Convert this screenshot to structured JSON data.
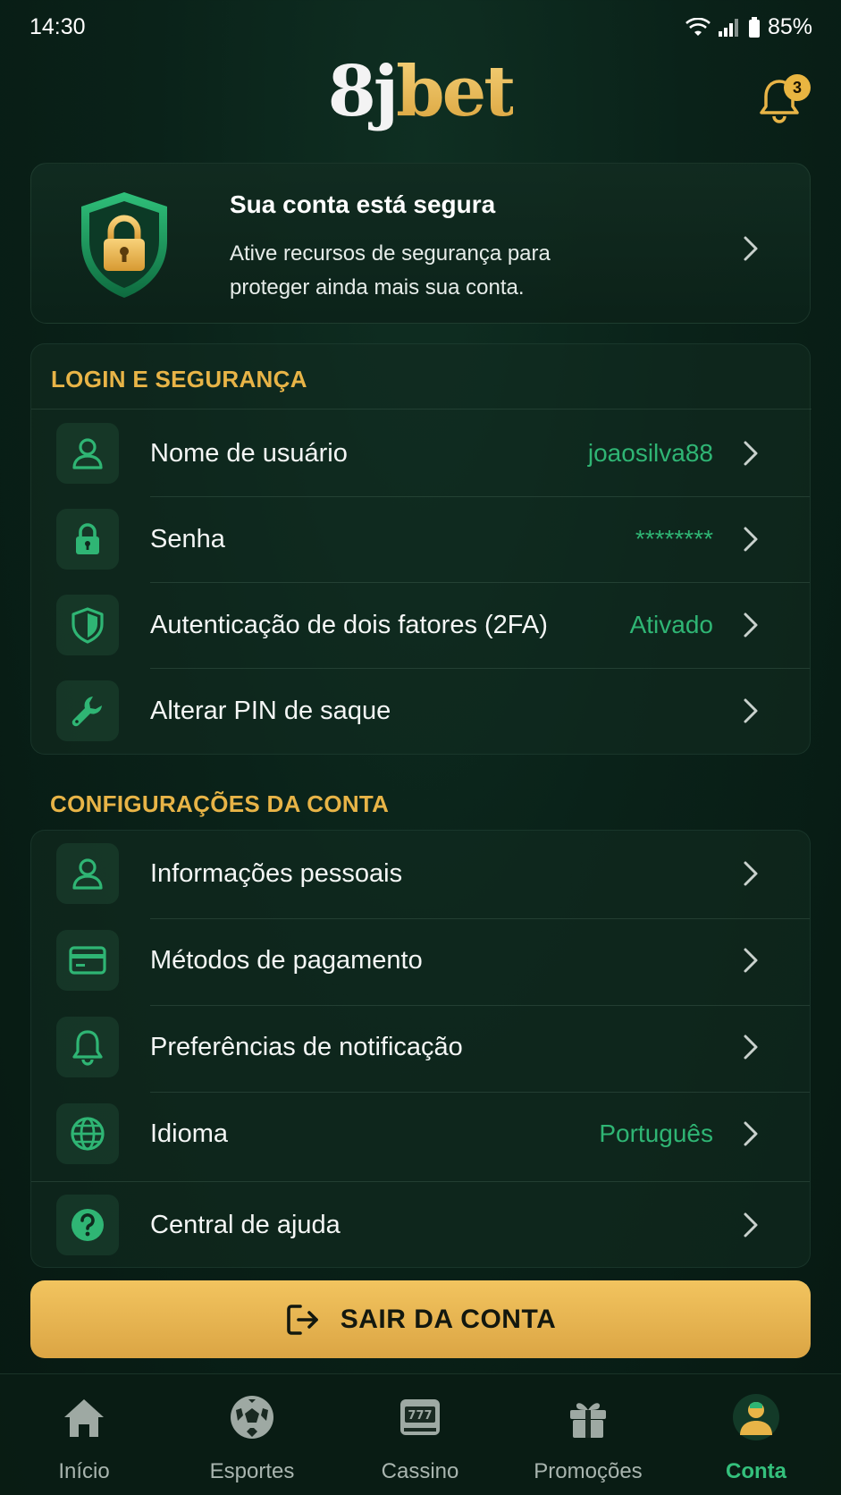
{
  "status_bar": {
    "time": "14:30",
    "battery": "85%"
  },
  "header": {
    "logo_part1": "8j",
    "logo_part2": "bet",
    "notification_count": "3"
  },
  "security_banner": {
    "title": "Sua conta está segura",
    "description": "Ative recursos de segurança para proteger ainda mais sua conta."
  },
  "login_section": {
    "title": "LOGIN E SEGURANÇA",
    "items": [
      {
        "label": "Nome de usuário",
        "value": "joaosilva88",
        "icon": "user-icon"
      },
      {
        "label": "Senha",
        "value": "********",
        "icon": "lock-icon"
      },
      {
        "label": "Autenticação de dois fatores (2FA)",
        "value": "Ativado",
        "icon": "shield-icon"
      },
      {
        "label": "Alterar PIN de saque",
        "value": "",
        "icon": "wrench-icon"
      }
    ]
  },
  "account_section": {
    "title": "CONFIGURAÇÕES DA CONTA",
    "items": [
      {
        "label": "Informações pessoais",
        "value": "",
        "icon": "user-icon"
      },
      {
        "label": "Métodos de pagamento",
        "value": "",
        "icon": "credit-card-icon"
      },
      {
        "label": "Preferências de notificação",
        "value": "",
        "icon": "bell-icon"
      },
      {
        "label": "Idioma",
        "value": "Português",
        "icon": "globe-icon"
      },
      {
        "label": "Central de ajuda",
        "value": "",
        "icon": "help-icon"
      }
    ]
  },
  "logout": {
    "label": "SAIR DA CONTA"
  },
  "bottom_nav": {
    "items": [
      {
        "label": "Início",
        "icon": "home-icon"
      },
      {
        "label": "Esportes",
        "icon": "soccer-ball-icon"
      },
      {
        "label": "Cassino",
        "icon": "slot-machine-icon"
      },
      {
        "label": "Promoções",
        "icon": "gift-icon"
      },
      {
        "label": "Conta",
        "icon": "account-icon",
        "active": true
      }
    ]
  },
  "colors": {
    "accent_gold": "#e8b447",
    "accent_green": "#2fb574",
    "background": "#0a2219"
  }
}
